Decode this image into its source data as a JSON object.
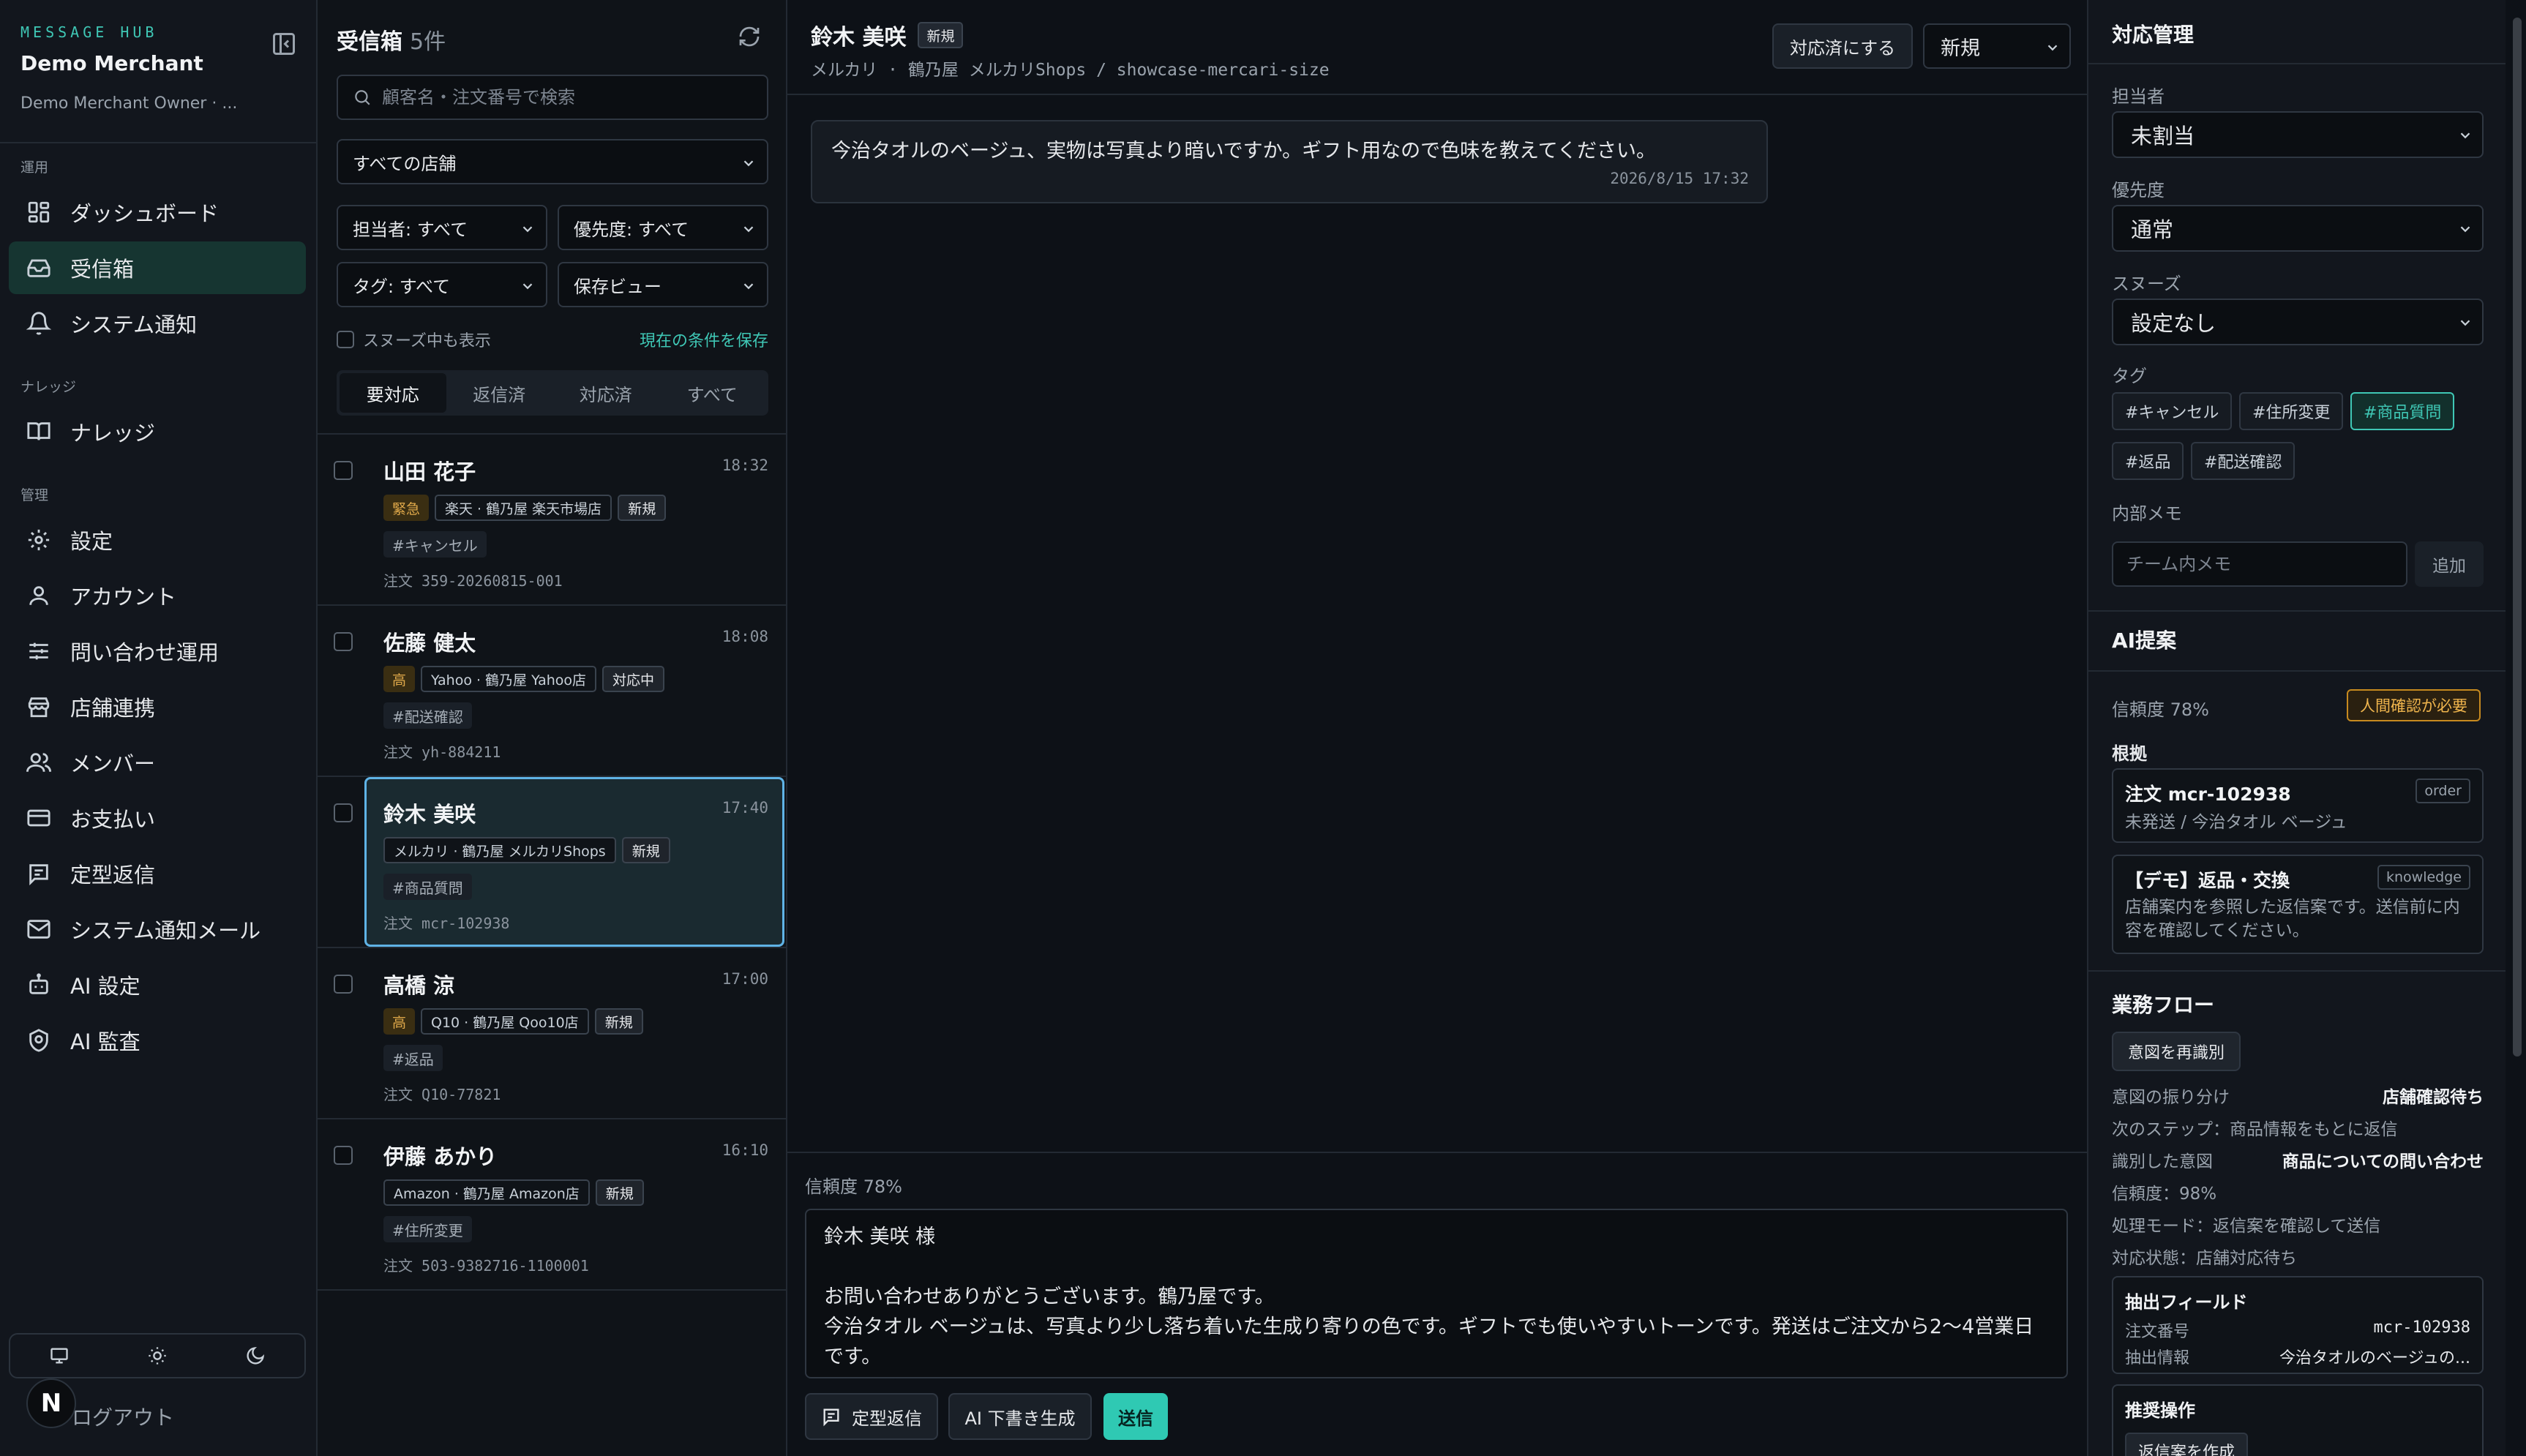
{
  "sidebar": {
    "eyebrow": "MESSAGE HUB",
    "merchant": "Demo Merchant",
    "owner": "Demo Merchant Owner · ...",
    "sections": {
      "ops": "運用",
      "knowledge": "ナレッジ",
      "admin": "管理"
    },
    "items": [
      {
        "label": "ダッシュボード",
        "icon": "dashboard-icon"
      },
      {
        "label": "受信箱",
        "icon": "inbox-icon",
        "active": true
      },
      {
        "label": "システム通知",
        "icon": "bell-icon"
      },
      {
        "label": "ナレッジ",
        "icon": "book-icon"
      },
      {
        "label": "設定",
        "icon": "gear-icon"
      },
      {
        "label": "アカウント",
        "icon": "user-icon"
      },
      {
        "label": "問い合わせ運用",
        "icon": "sliders-icon"
      },
      {
        "label": "店舗連携",
        "icon": "store-icon"
      },
      {
        "label": "メンバー",
        "icon": "users-icon"
      },
      {
        "label": "お支払い",
        "icon": "card-icon"
      },
      {
        "label": "定型返信",
        "icon": "template-icon"
      },
      {
        "label": "システム通知メール",
        "icon": "mail-icon"
      },
      {
        "label": "AI 設定",
        "icon": "bot-icon"
      },
      {
        "label": "AI 監査",
        "icon": "audit-icon"
      }
    ],
    "logout": "ログアウト",
    "avatar_letter": "N"
  },
  "inbox": {
    "title": "受信箱",
    "count": "5件",
    "search_placeholder": "顧客名・注文番号で検索",
    "store_filter": "すべての店舗",
    "assignee_filter": "担当者: すべて",
    "priority_filter": "優先度: すべて",
    "tag_filter": "タグ: すべて",
    "saved_view": "保存ビュー",
    "snooze_toggle": "スヌーズ中も表示",
    "save_condition": "現在の条件を保存",
    "tabs": [
      "要対応",
      "返信済",
      "対応済",
      "すべて"
    ],
    "conversations": [
      {
        "name": "山田 花子",
        "time": "18:32",
        "priority": "緊急",
        "store": "楽天 · 鶴乃屋 楽天市場店",
        "status": "新規",
        "tag": "#キャンセル",
        "order": "注文 359-20260815-001"
      },
      {
        "name": "佐藤 健太",
        "time": "18:08",
        "priority": "高",
        "store": "Yahoo · 鶴乃屋 Yahoo店",
        "status": "対応中",
        "tag": "#配送確認",
        "order": "注文 yh-884211"
      },
      {
        "name": "鈴木 美咲",
        "time": "17:40",
        "priority": "",
        "store": "メルカリ · 鶴乃屋 メルカリShops",
        "status": "新規",
        "tag": "#商品質問",
        "order": "注文 mcr-102938"
      },
      {
        "name": "高橋 涼",
        "time": "17:00",
        "priority": "高",
        "store": "Q10 · 鶴乃屋 Qoo10店",
        "status": "新規",
        "tag": "#返品",
        "order": "注文 Q10-77821"
      },
      {
        "name": "伊藤 あかり",
        "time": "16:10",
        "priority": "",
        "store": "Amazon · 鶴乃屋 Amazon店",
        "status": "新規",
        "tag": "#住所変更",
        "order": "注文 503-9382716-1100001"
      }
    ]
  },
  "thread": {
    "customer": "鈴木 美咲",
    "badge": "新規",
    "subtitle": "メルカリ · 鶴乃屋 メルカリShops / showcase-mercari-size",
    "resolve_button": "対応済にする",
    "status_value": "新規",
    "message": {
      "text": "今治タオルのベージュ、実物は写真より暗いですか。ギフト用なので色味を教えてください。",
      "time": "2026/8/15 17:32"
    },
    "confidence": "信頼度 78%",
    "draft": "鈴木 美咲 様\n\nお問い合わせありがとうございます。鶴乃屋です。\n今治タオル ベージュは、写真より少し落ち着いた生成り寄りの色です。ギフトでも使いやすいトーンです。発送はご注文から2〜4営業日です。",
    "template_button": "定型返信",
    "ai_draft_button": "AI 下書き生成",
    "send_button": "送信"
  },
  "panel": {
    "title": "対応管理",
    "assignee_label": "担当者",
    "assignee_value": "未割当",
    "priority_label": "優先度",
    "priority_value": "通常",
    "snooze_label": "スヌーズ",
    "snooze_value": "設定なし",
    "tags_label": "タグ",
    "tags": [
      {
        "label": "#キャンセル",
        "on": false
      },
      {
        "label": "#住所変更",
        "on": false
      },
      {
        "label": "#商品質問",
        "on": true
      },
      {
        "label": "#返品",
        "on": false
      },
      {
        "label": "#配送確認",
        "on": false
      }
    ],
    "memo_label": "内部メモ",
    "memo_placeholder": "チーム内メモ",
    "memo_add": "追加",
    "ai_title": "AI提案",
    "ai_confidence": "信頼度 78%",
    "ai_warning": "人間確認が必要",
    "evidence_label": "根拠",
    "evidence": [
      {
        "title": "注文 mcr-102938",
        "type": "order",
        "desc": "未発送 / 今治タオル ベージュ"
      },
      {
        "title": "【デモ】返品・交換",
        "type": "knowledge",
        "desc": "店舗案内を参照した返信案です。送信前に内容を確認してください。"
      }
    ],
    "flow_title": "業務フロー",
    "flow_button": "意図を再識別",
    "routing_label": "意図の振り分け",
    "routing_value": "店舗確認待ち",
    "next_step": "次のステップ：商品情報をもとに返信",
    "intent_label": "識別した意図",
    "intent_value": "商品についての問い合わせ",
    "intent_confidence": "信頼度：98%",
    "mode": "処理モード：返信案を確認して送信",
    "state": "対応状態：店舗対応待ち",
    "extract_title": "抽出フィールド",
    "extract_order_label": "注文番号",
    "extract_order_value": "mcr-102938",
    "extract_info_label": "抽出情報",
    "extract_info_value": "今治タオルのベージュの...",
    "recommend_title": "推奨操作",
    "recommend_button": "返信案を作成"
  }
}
